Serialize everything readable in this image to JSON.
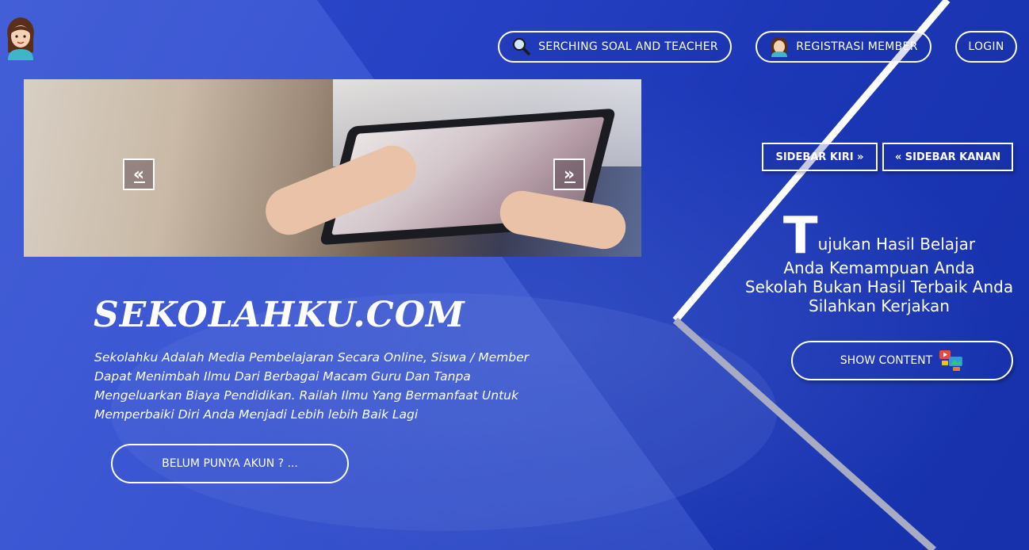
{
  "nav": {
    "search_label": "SERCHING SOAL AND TEACHER",
    "register_label": "REGISTRASI MEMBER",
    "login_label": "LOGIN"
  },
  "slider": {
    "prev_symbol": "«",
    "next_symbol": "»"
  },
  "hero": {
    "brand": "SEKOLAHKU.COM",
    "description": "Sekolahku Adalah Media Pembelajaran Secara Online, Siswa / Member Dapat Menimbah Ilmu Dari Berbagai Macam Guru Dan Tanpa Mengeluarkan Biaya Pendidikan. Railah Ilmu Yang Bermanfaat Untuk Memperbaiki Diri Anda Menjadi Lebih lebih Baik Lagi",
    "cta_label": "BELUM PUNYA AKUN ? ..."
  },
  "sidebar_buttons": {
    "left_label": "SIDEBAR KIRI »",
    "right_label": "« SIDEBAR KANAN"
  },
  "tagline": {
    "first_letter": "T",
    "line1_rest": "ujukan Hasil Belajar",
    "line2": "Anda Kemampuan Anda",
    "line3": "Sekolah Bukan Hasil Terbaik Anda",
    "line4": "Silahkan Kerjakan"
  },
  "show_content_label": "SHOW CONTENT",
  "icons": {
    "avatar": "girl-avatar-icon",
    "search": "magnifier-icon",
    "register": "girl-avatar-icon",
    "show_content": "media-icon"
  },
  "colors": {
    "background": "#1e3cc0",
    "text": "#ffffff",
    "divider": "#ffffff",
    "divider_shadow": "#9aa0b8"
  }
}
